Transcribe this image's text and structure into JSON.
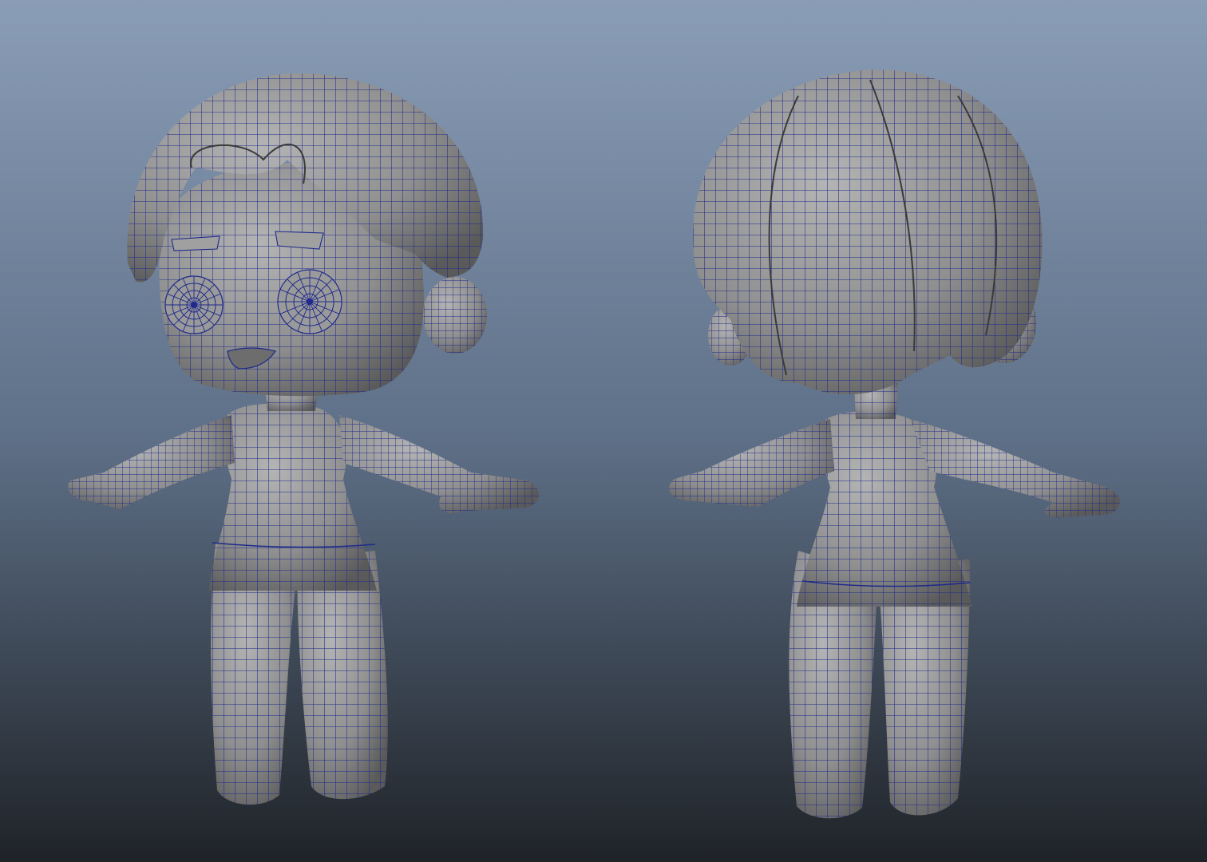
{
  "viewport": {
    "background_top": "#8a9db6",
    "background_mid": "#5f7189",
    "background_bottom": "#1f2328"
  },
  "model": {
    "surface_color": "#8f8f8f",
    "surface_light": "#b4b4b4",
    "surface_dark": "#5a5a5a",
    "wire_color": "#1f2a8c"
  },
  "figures": [
    {
      "view": "front",
      "icon": "character-front-view-icon"
    },
    {
      "view": "back",
      "icon": "character-back-view-icon"
    }
  ]
}
